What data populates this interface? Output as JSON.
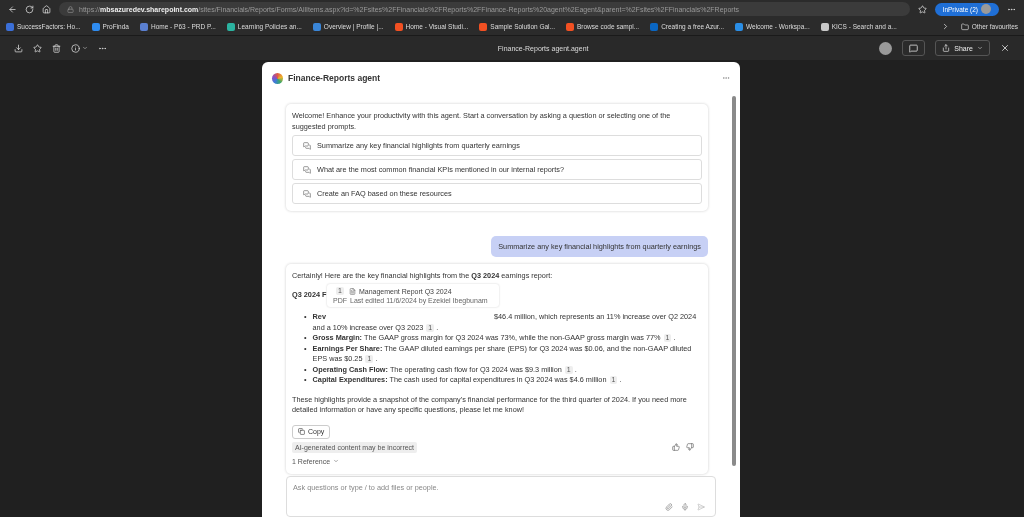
{
  "browser": {
    "address": {
      "scheme": "https://",
      "host": "mbsazuredev.sharepoint.com",
      "path": "/sites/Financials/Reports/Forms/AllItems.aspx?id=%2Fsites%2FFinancials%2FReports%2FFinance-Reports%20agent%2Eagent&parent=%2Fsites%2FFinancials%2FReports"
    },
    "profile": "InPrivate (2)",
    "bookmarks": [
      {
        "label": "SuccessFactors: Ho...",
        "color": "#3b6fd8"
      },
      {
        "label": "ProFinda",
        "color": "#2f8cf0"
      },
      {
        "label": "Home - P63 - PRD P...",
        "color": "#5a7fd0"
      },
      {
        "label": "Learning Policies an...",
        "color": "#2bb3a0"
      },
      {
        "label": "Overview | Profile |...",
        "color": "#3a86d8"
      },
      {
        "label": "Home - Visual Studi...",
        "color": "#f25022"
      },
      {
        "label": "Sample Solution Gal...",
        "color": "#f25022"
      },
      {
        "label": "Browse code sampl...",
        "color": "#f25022"
      },
      {
        "label": "Creating a free Azur...",
        "color": "#0a66c2"
      },
      {
        "label": "Welcome - Workspa...",
        "color": "#2a8ee6"
      },
      {
        "label": "KICS - Search and a...",
        "color": "#c8c8c8"
      }
    ],
    "other_favourites": "Other favourites"
  },
  "viewer": {
    "title": "Finance-Reports agent.agent",
    "share": "Share"
  },
  "agent": {
    "title": "Finance-Reports agent",
    "welcome": "Welcome! Enhance your productivity with this agent. Start a conversation by asking a question or selecting one of the suggested prompts.",
    "prompts": [
      "Summarize any key financial highlights from quarterly earnings",
      "What are the most common financial KPIs mentioned in our internal reports?",
      "Create an FAQ based on these resources"
    ],
    "user_message": "Summarize any key financial highlights from quarterly earnings",
    "response": {
      "intro": "Certainly! Here are the key financial highlights from the **Q3 2024** earnings report:",
      "heading": "Q3 2024 F",
      "bullets": [
        {
          "kind": "partly_hidden",
          "marker": "•",
          "end": ".",
          "label": "Rev",
          "text": "$46.4 million, which represents an 11% increase over Q2 2024 and a 10% increase over Q3 2023",
          "ref": "1"
        },
        {
          "kind": "full",
          "marker": "•",
          "end": ".",
          "label": "Gross Margin:",
          "text": "The GAAP gross margin for Q3 2024 was 73%, while the non-GAAP gross margin was 77%",
          "ref": "1"
        },
        {
          "kind": "full",
          "marker": "•",
          "end": ".",
          "label": "Earnings Per Share:",
          "text": "The GAAP diluted earnings per share (EPS) for Q3 2024 was $0.06, and the non-GAAP diluted EPS was $0.25",
          "ref": "1"
        },
        {
          "kind": "full",
          "marker": "•",
          "end": ".",
          "label": "Operating Cash Flow:",
          "text": "The operating cash flow for Q3 2024 was $9.3 million",
          "ref": "1"
        },
        {
          "kind": "full",
          "marker": "•",
          "end": ".",
          "label": "Capital Expenditures:",
          "text": "The cash used for capital expenditures in Q3 2024 was $4.6 million",
          "ref": "1"
        }
      ],
      "closing": "These highlights provide a snapshot of the company's financial performance for the third quarter of 2024. If you need more detailed information or have any specific questions, please let me know!",
      "copy": "Copy",
      "disclaimer": "AI-generated content may be incorrect",
      "references": "1 Reference"
    },
    "tooltip": {
      "ref": "1",
      "title": "Management Report Q3 2024",
      "type": "PDF",
      "meta": "Last edited 11/6/2024 by Ezekiel Ibegbunam"
    },
    "composer": {
      "placeholder": "Ask questions or type / to add files or people."
    }
  }
}
